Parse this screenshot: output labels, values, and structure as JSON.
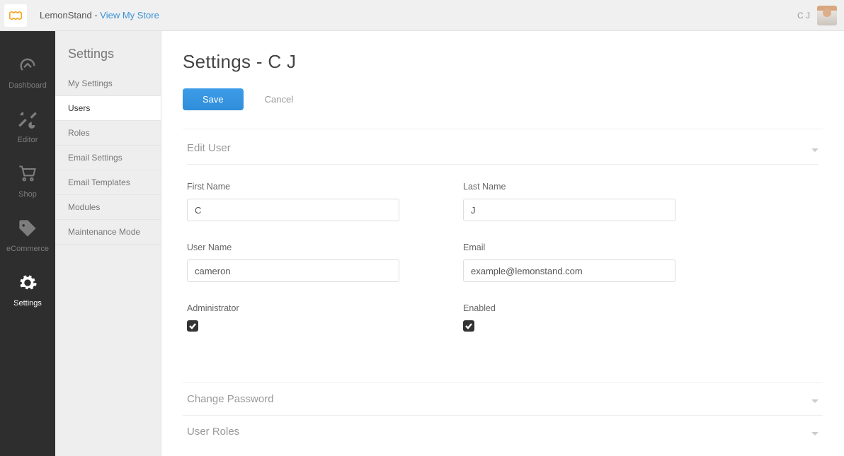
{
  "header": {
    "brand_prefix": "LemonStand - ",
    "brand_link": "View My Store",
    "user_initials": "C J"
  },
  "mainnav": {
    "items": [
      {
        "label": "Dashboard",
        "icon": "gauge-icon"
      },
      {
        "label": "Editor",
        "icon": "tools-icon"
      },
      {
        "label": "Shop",
        "icon": "cart-icon"
      },
      {
        "label": "eCommerce",
        "icon": "tag-icon"
      },
      {
        "label": "Settings",
        "icon": "gear-icon"
      }
    ],
    "active_index": 4
  },
  "subnav": {
    "title": "Settings",
    "items": [
      "My Settings",
      "Users",
      "Roles",
      "Email Settings",
      "Email Templates",
      "Modules",
      "Maintenance Mode"
    ],
    "active_index": 1
  },
  "page": {
    "title": "Settings - C J",
    "save_label": "Save",
    "cancel_label": "Cancel"
  },
  "sections": {
    "edit_user": {
      "title": "Edit User"
    },
    "change_password": {
      "title": "Change Password"
    },
    "user_roles": {
      "title": "User Roles"
    }
  },
  "form": {
    "first_name": {
      "label": "First Name",
      "value": "C"
    },
    "last_name": {
      "label": "Last Name",
      "value": "J"
    },
    "user_name": {
      "label": "User Name",
      "value": "cameron"
    },
    "email": {
      "label": "Email",
      "value": "example@lemonstand.com"
    },
    "administrator": {
      "label": "Administrator",
      "checked": true
    },
    "enabled": {
      "label": "Enabled",
      "checked": true
    }
  }
}
